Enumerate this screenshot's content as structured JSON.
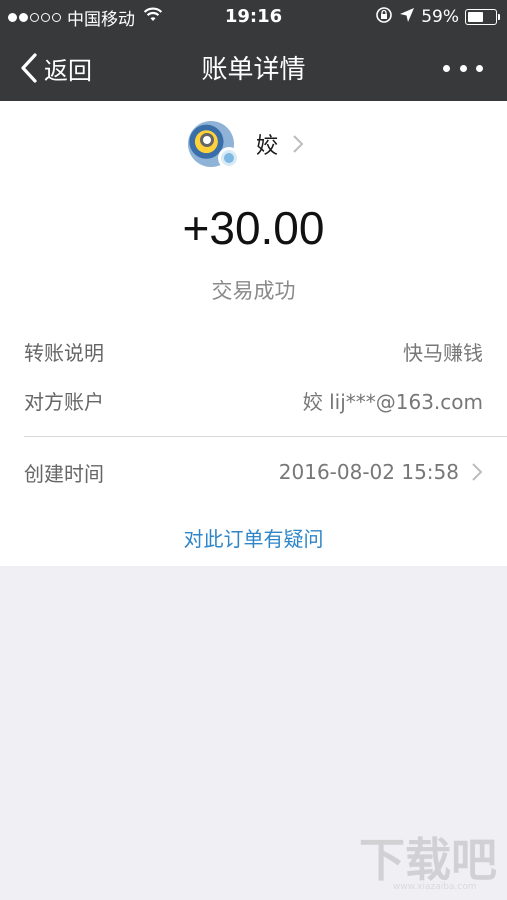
{
  "status_bar": {
    "carrier": "中国移动",
    "time": "19:16",
    "battery_percent": "59%",
    "battery_level": 0.59
  },
  "nav": {
    "back_label": "返回",
    "title": "账单详情"
  },
  "payee": {
    "name": "姣"
  },
  "transaction": {
    "amount": "+30.00",
    "status": "交易成功"
  },
  "details": {
    "note_label": "转账说明",
    "note_value": "快马赚钱",
    "account_label": "对方账户",
    "account_value": "姣 lij***@163.com",
    "created_label": "创建时间",
    "created_value": "2016-08-02 15:58"
  },
  "question_link": "对此订单有疑问",
  "watermark": {
    "url": "www.xiazaiba.com"
  },
  "colors": {
    "header_bg": "#38393b",
    "link": "#2f86c8",
    "page_bg": "#f0f0f4"
  }
}
